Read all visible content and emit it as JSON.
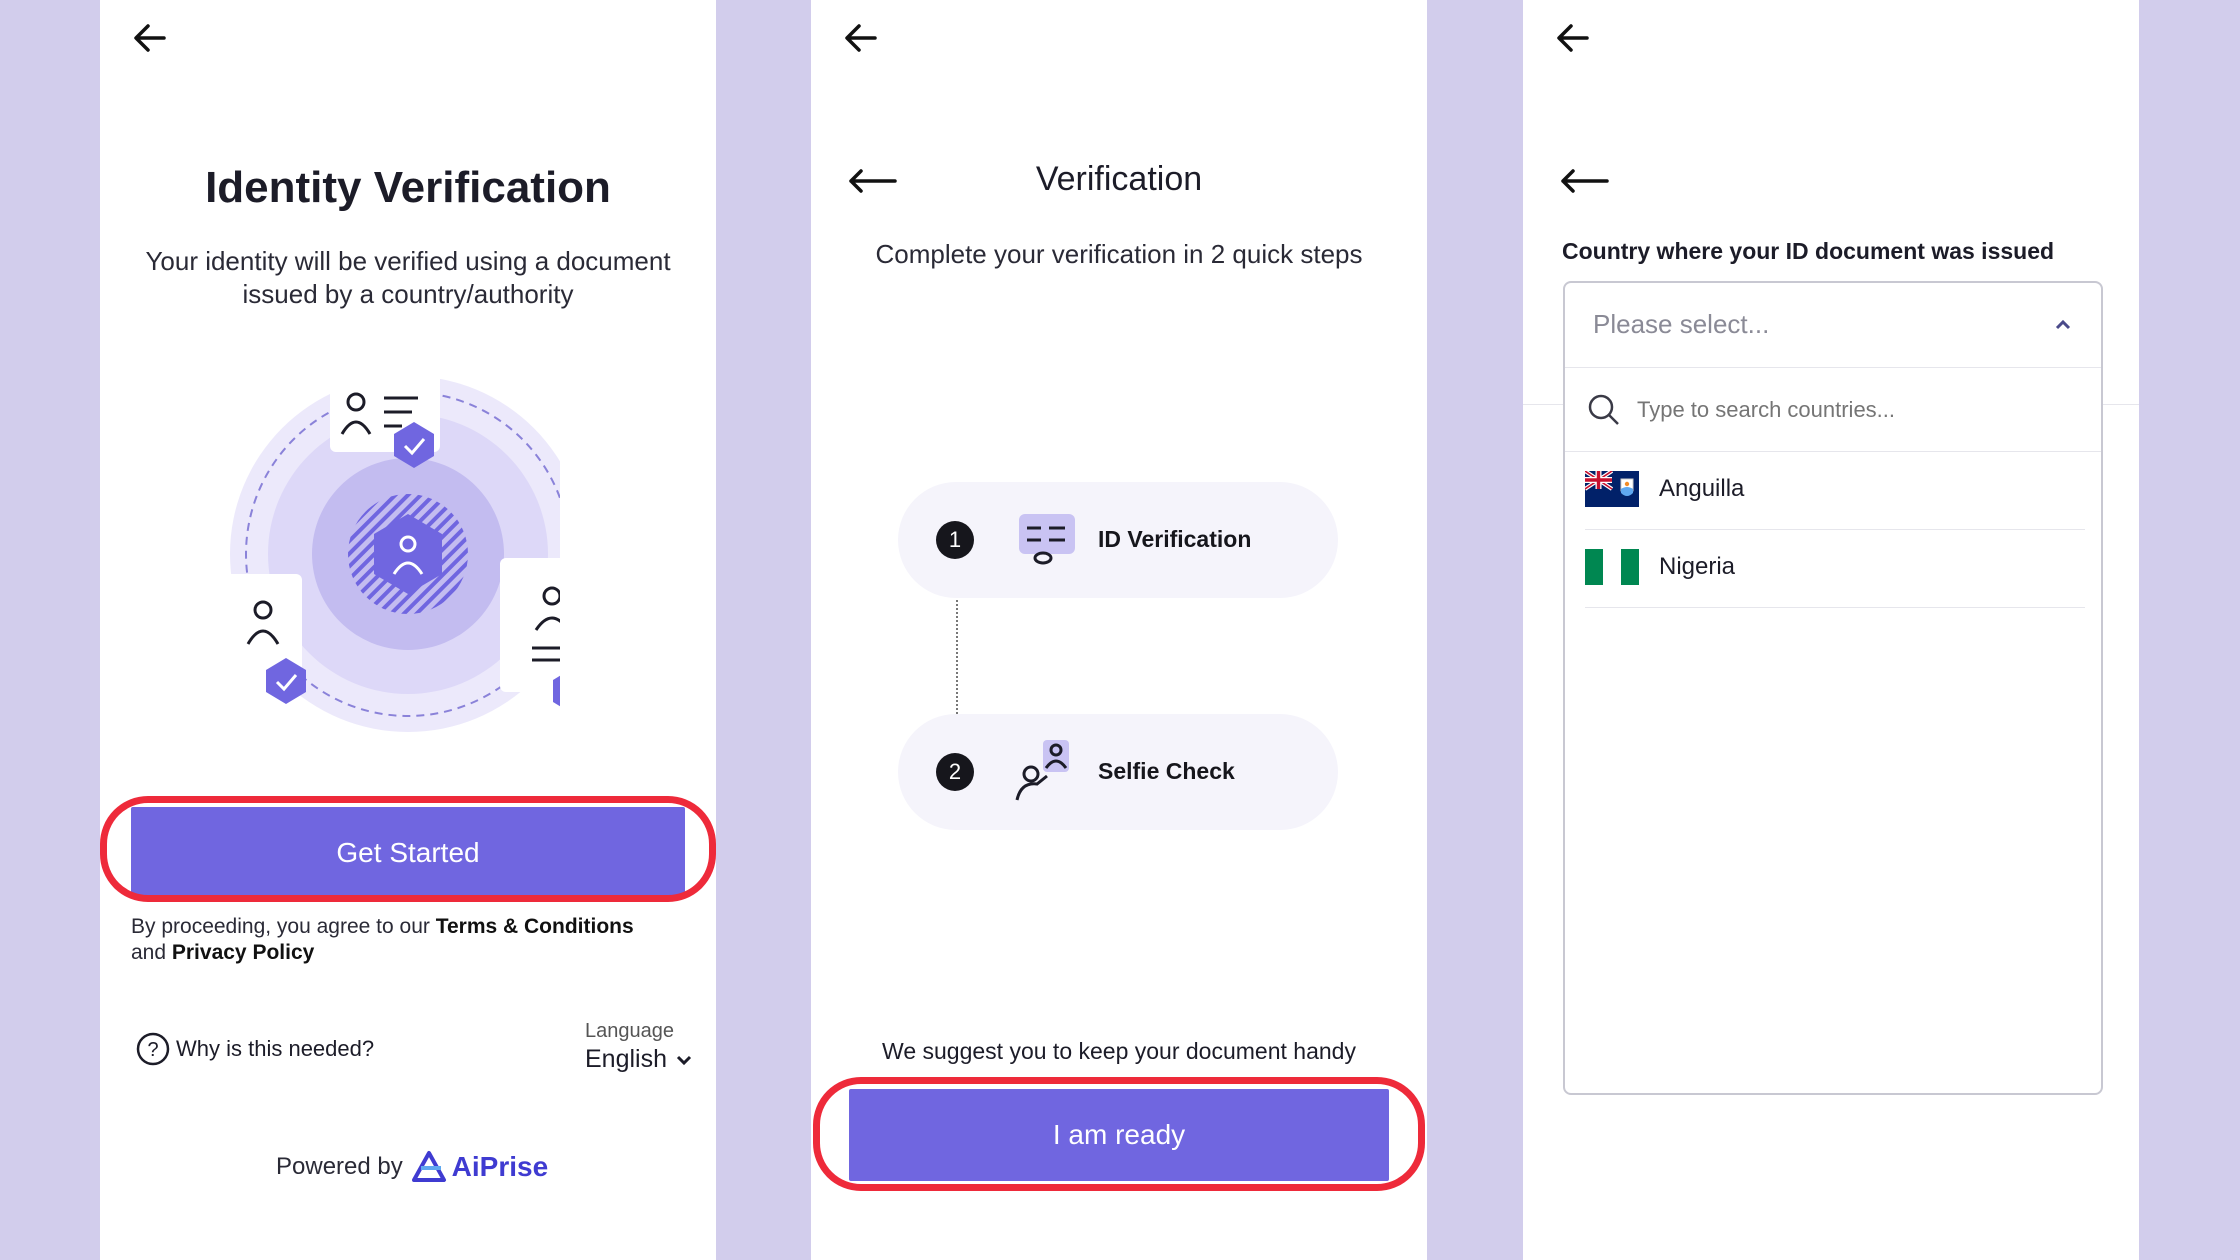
{
  "screen1": {
    "title": "Identity Verification",
    "subtitle_line1": "Your identity will be verified using a document",
    "subtitle_line2": "issued by a country/authority",
    "cta": "Get Started",
    "terms_prefix": "By proceeding, you agree to our ",
    "terms_link": "Terms & Conditions",
    "terms_and": "and ",
    "privacy_link": "Privacy Policy",
    "help": "Why is this needed?",
    "language_label": "Language",
    "language_value": "English",
    "powered_by": "Powered by",
    "brand": "AiPrise",
    "brand_color": "#3f3bd1"
  },
  "screen2": {
    "title": "Verification",
    "subtitle": "Complete your verification in 2 quick steps",
    "steps": [
      {
        "number": "1",
        "label": "ID Verification",
        "icon": "id-card-icon"
      },
      {
        "number": "2",
        "label": "Selfie Check",
        "icon": "selfie-icon"
      }
    ],
    "hint": "We suggest you to keep your document handy",
    "cta": "I am ready"
  },
  "screen3": {
    "field_label": "Country where your ID document was issued",
    "select_placeholder": "Please select...",
    "search_placeholder": "Type to search countries...",
    "options": [
      {
        "label": "Anguilla",
        "flag": "anguilla-flag-icon"
      },
      {
        "label": "Nigeria",
        "flag": "nigeria-flag-icon"
      }
    ]
  },
  "colors": {
    "accent": "#7066e0",
    "highlight_ring": "#ee2a3a",
    "backdrop": "#d2cdec"
  }
}
